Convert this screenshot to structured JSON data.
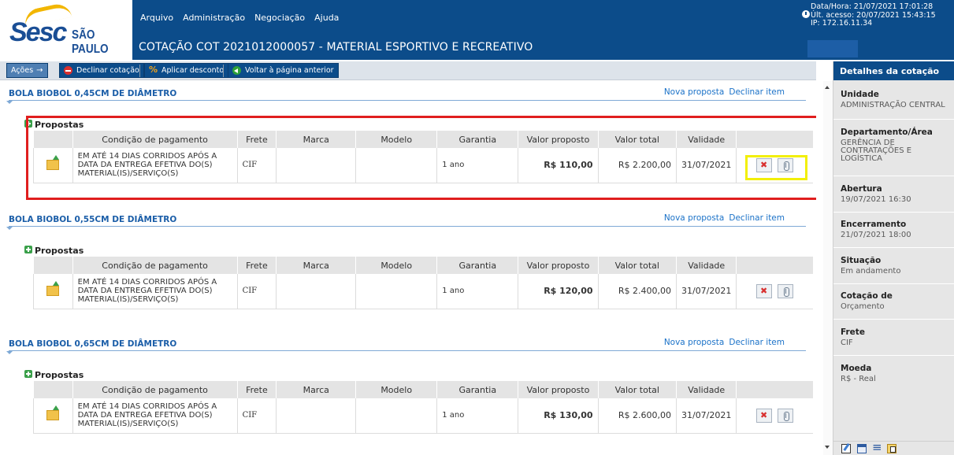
{
  "header": {
    "logo_brand": "Sesc",
    "logo_city": "SÃO PAULO",
    "menu": [
      "Arquivo",
      "Administração",
      "Negociação",
      "Ajuda"
    ],
    "page_title": "COTAÇÃO COT 2021012000057 - MATERIAL ESPORTIVO E RECREATIVO",
    "session": {
      "datetime": "Data/Hora: 21/07/2021 17:01:28",
      "last_access": "Últ. acesso: 20/07/2021 15:43:15",
      "ip": "IP: 172.16.11.34"
    }
  },
  "toolbar": {
    "acoes": "Ações",
    "declinar": "Declinar cotação",
    "desconto": "Aplicar desconto",
    "voltar": "Voltar à página anterior"
  },
  "common": {
    "nova_proposta": "Nova proposta",
    "declinar_item": "Declinar item",
    "propostas": "Propostas",
    "columns": [
      "Condição de pagamento",
      "Frete",
      "Marca",
      "Modelo",
      "Garantia",
      "Valor proposto",
      "Valor total",
      "Validade"
    ]
  },
  "items": [
    {
      "title": "BOLA BIOBOL 0,45CM DE DIÂMETRO",
      "row": {
        "condicao": "EM ATÉ 14 DIAS CORRIDOS APÓS A DATA DA ENTREGA EFETIVA DO(S) MATERIAL(IS)/SERVIÇO(S)",
        "frete": "CIF",
        "marca": "",
        "modelo": "",
        "garantia": "1 ano",
        "valor_proposto": "R$ 110,00",
        "valor_total": "R$ 2.200,00",
        "validade": "31/07/2021"
      }
    },
    {
      "title": "BOLA BIOBOL 0,55CM DE DIÂMETRO",
      "row": {
        "condicao": "EM ATÉ 14 DIAS CORRIDOS APÓS A DATA DA ENTREGA EFETIVA DO(S) MATERIAL(IS)/SERVIÇO(S)",
        "frete": "CIF",
        "marca": "",
        "modelo": "",
        "garantia": "1 ano",
        "valor_proposto": "R$ 120,00",
        "valor_total": "R$ 2.400,00",
        "validade": "31/07/2021"
      }
    },
    {
      "title": "BOLA BIOBOL 0,65CM DE DIÂMETRO",
      "row": {
        "condicao": "EM ATÉ 14 DIAS CORRIDOS APÓS A DATA DA ENTREGA EFETIVA DO(S) MATERIAL(IS)/SERVIÇO(S)",
        "frete": "CIF",
        "marca": "",
        "modelo": "",
        "garantia": "1 ano",
        "valor_proposto": "R$ 130,00",
        "valor_total": "R$ 2.600,00",
        "validade": "31/07/2021"
      }
    }
  ],
  "sidebar": {
    "title": "Detalhes da cotação",
    "fields": [
      {
        "label": "Unidade",
        "value": "ADMINISTRAÇÃO CENTRAL"
      },
      {
        "label": "Departamento/Área",
        "value": "GERÊNCIA DE CONTRATAÇÕES E LOGÍSTICA"
      },
      {
        "label": "Abertura",
        "value": "19/07/2021 16:30"
      },
      {
        "label": "Encerramento",
        "value": "21/07/2021 18:00"
      },
      {
        "label": "Situação",
        "value": "Em andamento"
      },
      {
        "label": "Cotação de",
        "value": "Orçamento"
      },
      {
        "label": "Frete",
        "value": "CIF"
      },
      {
        "label": "Moeda",
        "value": "R$ - Real"
      }
    ]
  },
  "colors": {
    "header": "#0c4c8a",
    "link": "#1b72c8",
    "title": "#1b5ea8",
    "highlight_red": "#e01e1e",
    "highlight_yellow": "#f2ef07"
  },
  "icons": [
    "clock-icon",
    "decline-icon",
    "discount-icon",
    "back-icon",
    "add-icon",
    "folder-upload-icon",
    "delete-icon",
    "attachment-icon",
    "edit-icon",
    "calendar-icon",
    "list-icon",
    "document-icon"
  ]
}
